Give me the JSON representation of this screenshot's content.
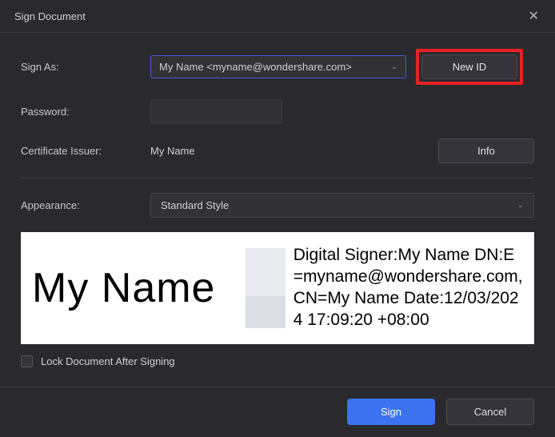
{
  "dialog": {
    "title": "Sign Document"
  },
  "form": {
    "sign_as_label": "Sign As:",
    "sign_as_value": "My Name <myname@wondershare.com>",
    "new_id_label": "New ID",
    "password_label": "Password:",
    "password_value": "",
    "cert_issuer_label": "Certificate Issuer:",
    "cert_issuer_value": "My Name",
    "info_label": "Info",
    "appearance_label": "Appearance:",
    "appearance_value": "Standard Style"
  },
  "preview": {
    "display_name": "My Name",
    "details": "Digital Signer:My Name DN:E=myname@wondershare.com, CN=My Name Date:12/03/2024 17:09:20 +08:00"
  },
  "lock": {
    "label": "Lock Document After Signing",
    "checked": false
  },
  "actions": {
    "sign": "Sign",
    "cancel": "Cancel"
  }
}
